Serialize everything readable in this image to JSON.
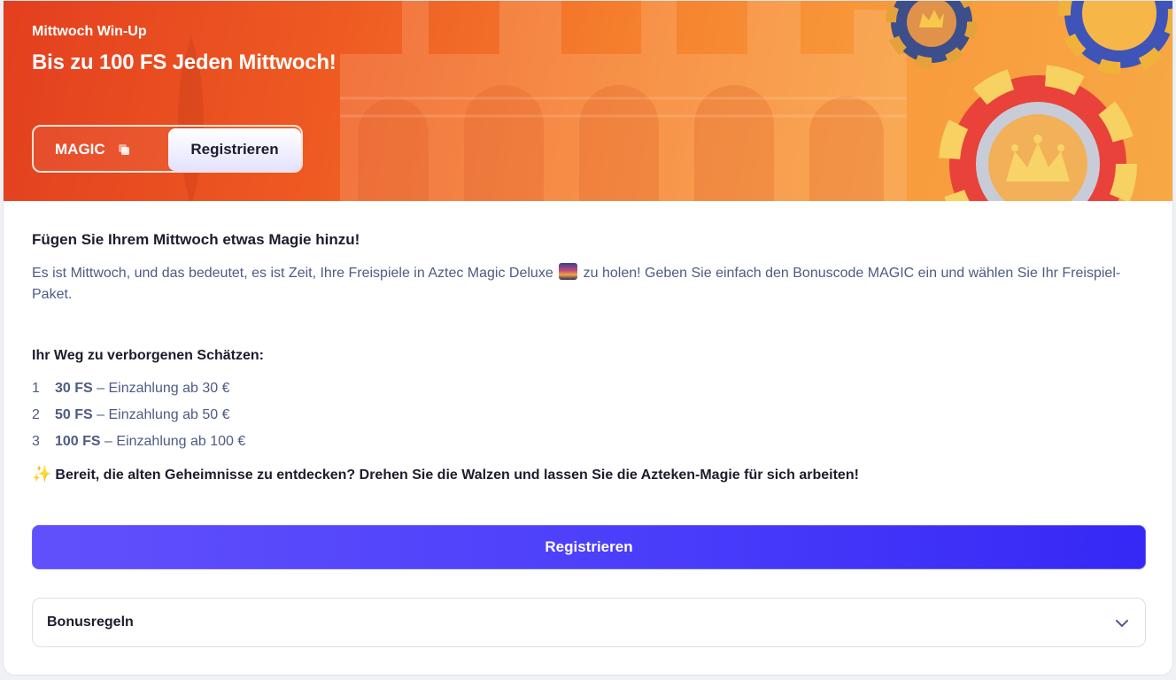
{
  "banner": {
    "tag": "Mittwoch Win-Up",
    "title": "Bis zu 100 FS Jeden Mittwoch!",
    "promo_code": "MAGIC",
    "register_label": "Registrieren"
  },
  "content": {
    "heading": "Fügen Sie Ihrem Mittwoch etwas Magie hinzu!",
    "description_part1": "Es ist Mittwoch, und das bedeutet, es ist Zeit, Ihre Freispiele in Aztec Magic Deluxe",
    "description_part2": "zu holen! Geben Sie einfach den Bonuscode MAGIC ein und wählen Sie Ihr Freispiel-Paket.",
    "tiers_heading": "Ihr Weg zu verborgenen Schätzen:",
    "tiers": [
      {
        "num": "1",
        "fs": "30 FS",
        "text": "– Einzahlung ab 30 €"
      },
      {
        "num": "2",
        "fs": "50 FS",
        "text": "– Einzahlung ab 50 €"
      },
      {
        "num": "3",
        "fs": "100 FS",
        "text": "– Einzahlung ab 100 €"
      }
    ],
    "cta_text": "Bereit, die alten Geheimnisse zu entdecken? Drehen Sie die Walzen und lassen Sie die Azteken-Magie für sich arbeiten!",
    "register_label": "Registrieren",
    "rules_label": "Bonusregeln"
  },
  "icons": {
    "copy": "copy-icon",
    "chevron": "chevron-down-icon",
    "sparkle": "sparkles-icon",
    "sunset": "sunset-emoji-icon"
  },
  "colors": {
    "banner_start": "#e33f1f",
    "banner_end": "#f7a845",
    "primary_button": "#4d40fb",
    "body_text": "#4e5b83",
    "heading_text": "#1c1c2e"
  }
}
